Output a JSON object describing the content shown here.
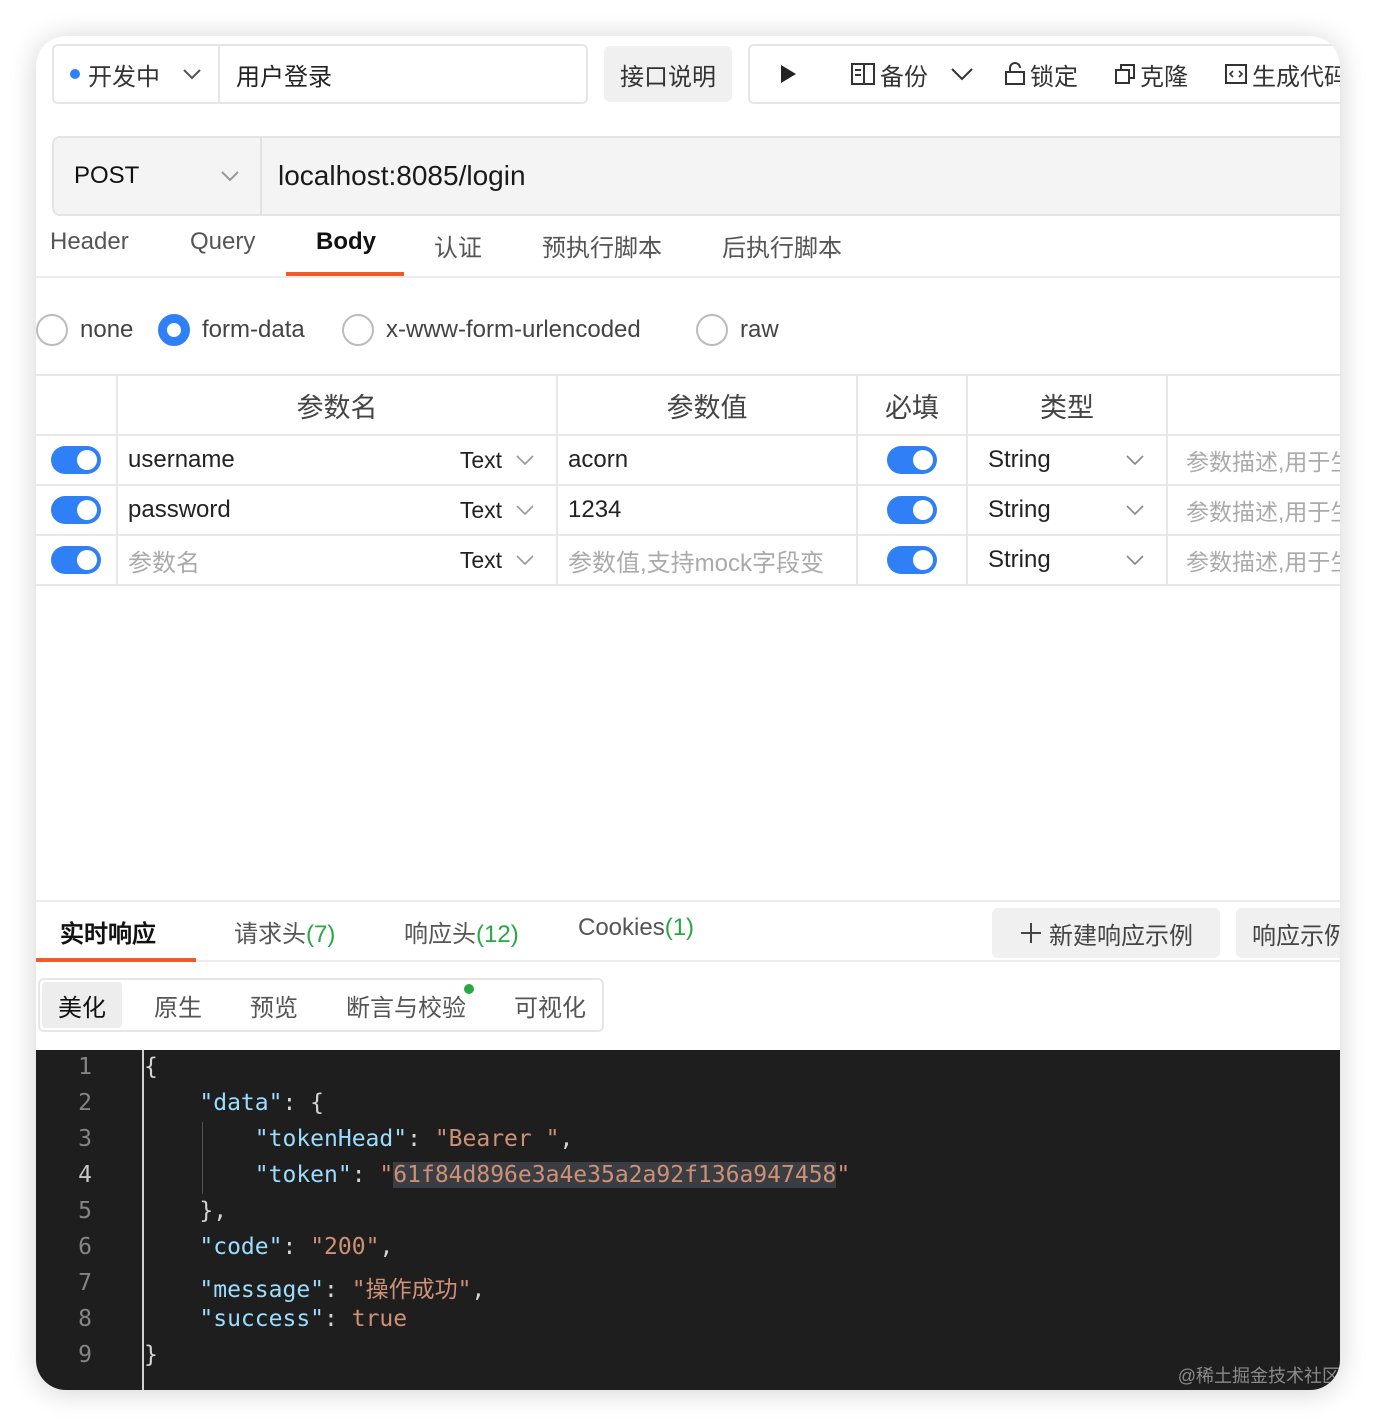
{
  "topbar": {
    "status": "开发中",
    "api_name": "用户登录",
    "doc_button": "接口说明",
    "tools": {
      "backup": "备份",
      "lock": "锁定",
      "clone": "克隆",
      "generate_code": "生成代码"
    }
  },
  "request": {
    "method": "POST",
    "url": "localhost:8085/login",
    "tabs": [
      "Header",
      "Query",
      "Body",
      "认证",
      "预执行脚本",
      "后执行脚本"
    ],
    "active_tab": "Body"
  },
  "body_types": {
    "options": [
      "none",
      "form-data",
      "x-www-form-urlencoded",
      "raw"
    ],
    "selected": "form-data"
  },
  "params": {
    "headers": [
      "参数名",
      "参数值",
      "必填",
      "类型"
    ],
    "rows": [
      {
        "name": "username",
        "kind": "Text",
        "value": "acorn",
        "type": "String",
        "desc_placeholder": "参数描述,用于生"
      },
      {
        "name": "password",
        "kind": "Text",
        "value": "1234",
        "type": "String",
        "desc_placeholder": "参数描述,用于生"
      }
    ],
    "new_row": {
      "name_placeholder": "参数名",
      "kind": "Text",
      "value_placeholder": "参数值,支持mock字段变",
      "type": "String",
      "desc_placeholder": "参数描述,用于生"
    }
  },
  "response": {
    "tabs": {
      "realtime": "实时响应",
      "req_headers": "请求头",
      "req_headers_count": "(7)",
      "resp_headers": "响应头",
      "resp_headers_count": "(12)",
      "cookies": "Cookies",
      "cookies_count": "(1)"
    },
    "new_example": "新建响应示例",
    "example": "响应示例",
    "view_tabs": [
      "美化",
      "原生",
      "预览",
      "断言与校验",
      "可视化"
    ],
    "code": {
      "line_numbers": [
        "1",
        "2",
        "3",
        "4",
        "5",
        "6",
        "7",
        "8",
        "9"
      ],
      "key_data": "\"data\"",
      "key_tokenHead": "\"tokenHead\"",
      "val_tokenHead": "\"Bearer \"",
      "key_token": "\"token\"",
      "val_token": "61f84d896e3a4e35a2a92f136a947458",
      "key_code": "\"code\"",
      "val_code": "\"200\"",
      "key_message": "\"message\"",
      "val_message": "\"操作成功\"",
      "key_success": "\"success\"",
      "val_success": "true"
    }
  },
  "watermark": "@稀土掘金技术社区"
}
